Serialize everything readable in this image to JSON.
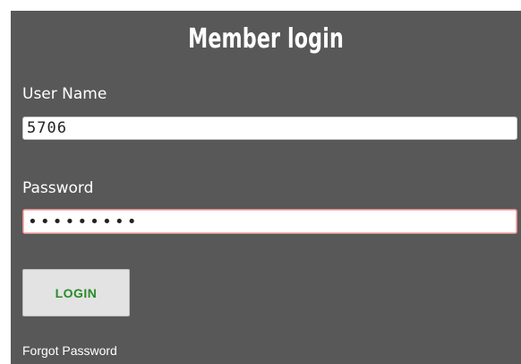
{
  "form": {
    "title": "Member login",
    "username": {
      "label": "User Name",
      "value": "5706"
    },
    "password": {
      "label": "Password",
      "value": "•••••••••"
    },
    "login_button_label": "LOGIN",
    "forgot_password_label": "Forgot Password"
  },
  "colors": {
    "panel_background": "#585858",
    "title_text": "#ffffff",
    "login_text": "#2a8a2a",
    "password_focus_border": "#e08a8a"
  }
}
